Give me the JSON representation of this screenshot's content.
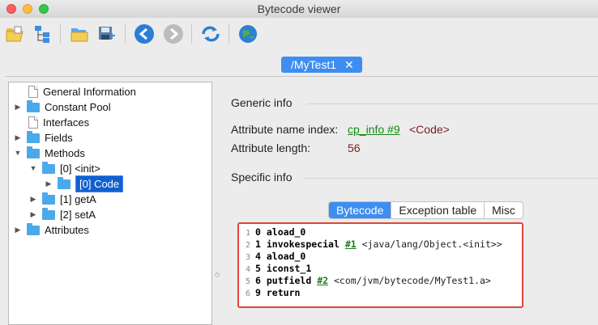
{
  "window": {
    "title": "Bytecode viewer"
  },
  "toolbar": {
    "buttons": [
      {
        "icon": "open-folder-icon"
      },
      {
        "icon": "hierarchy-icon"
      },
      {
        "icon": "open-folder-alt-icon"
      },
      {
        "icon": "save-icon"
      },
      {
        "icon": "back-arrow-icon"
      },
      {
        "icon": "forward-arrow-icon"
      },
      {
        "icon": "refresh-icon"
      },
      {
        "icon": "globe-icon"
      }
    ]
  },
  "document_tab": {
    "label": "/MyTest1",
    "close": "✕"
  },
  "tree": {
    "items": [
      {
        "label": "General Information",
        "type": "file",
        "expander": ""
      },
      {
        "label": "Constant Pool",
        "type": "folder",
        "expander": "▶"
      },
      {
        "label": "Interfaces",
        "type": "file",
        "expander": ""
      },
      {
        "label": "Fields",
        "type": "folder",
        "expander": "▶"
      },
      {
        "label": "Methods",
        "type": "folder",
        "expander": "▼"
      },
      {
        "label": "[0] <init>",
        "type": "folder",
        "expander": "▼"
      },
      {
        "label": "[0] Code",
        "type": "folder",
        "expander": "▶",
        "selected": true
      },
      {
        "label": "[1] getA",
        "type": "folder",
        "expander": "▶"
      },
      {
        "label": "[2] setA",
        "type": "folder",
        "expander": "▶"
      },
      {
        "label": "Attributes",
        "type": "folder",
        "expander": "▶"
      }
    ]
  },
  "generic_info": {
    "heading": "Generic info",
    "name_index_label": "Attribute name index:",
    "name_index_link": "cp_info #9",
    "name_index_value": "<Code>",
    "length_label": "Attribute length:",
    "length_value": "56"
  },
  "specific_info": {
    "heading": "Specific info",
    "tabs": [
      "Bytecode",
      "Exception table",
      "Misc"
    ],
    "active_tab": "Bytecode"
  },
  "bytecode": [
    {
      "line": "1",
      "offset": "0",
      "op": "aload_0",
      "ref": "",
      "comment": ""
    },
    {
      "line": "2",
      "offset": "1",
      "op": "invokespecial",
      "ref": "#1",
      "comment": "<java/lang/Object.<init>>"
    },
    {
      "line": "3",
      "offset": "4",
      "op": "aload_0",
      "ref": "",
      "comment": ""
    },
    {
      "line": "4",
      "offset": "5",
      "op": "iconst_1",
      "ref": "",
      "comment": ""
    },
    {
      "line": "5",
      "offset": "6",
      "op": "putfield",
      "ref": "#2",
      "comment": "<com/jvm/bytecode/MyTest1.a>"
    },
    {
      "line": "6",
      "offset": "9",
      "op": "return",
      "ref": "",
      "comment": ""
    }
  ],
  "colors": {
    "accent": "#3d8ef0",
    "selection": "#1060d0",
    "link": "#128a12",
    "highlight_border": "#e0453a"
  }
}
